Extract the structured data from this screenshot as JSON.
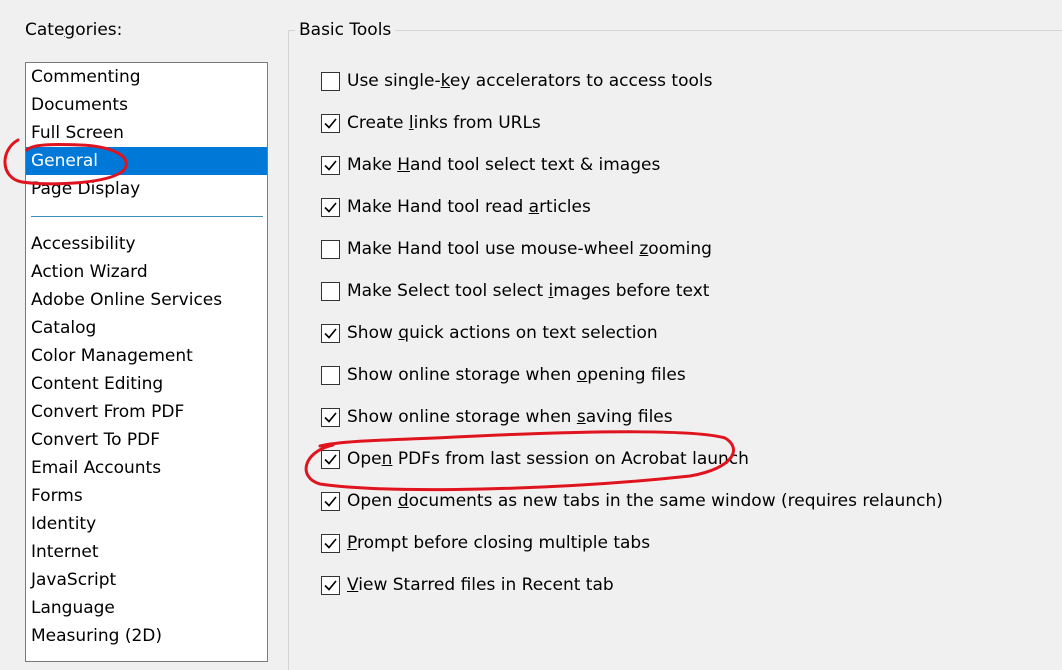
{
  "categories": {
    "label_pre": "Cate",
    "label_acc": "g",
    "label_post": "ories:",
    "items_top": [
      "Commenting",
      "Documents",
      "Full Screen",
      "General",
      "Page Display"
    ],
    "selected": "General",
    "items_bottom": [
      "Accessibility",
      "Action Wizard",
      "Adobe Online Services",
      "Catalog",
      "Color Management",
      "Content Editing",
      "Convert From PDF",
      "Convert To PDF",
      "Email Accounts",
      "Forms",
      "Identity",
      "Internet",
      "JavaScript",
      "Language",
      "Measuring (2D)"
    ]
  },
  "basic_tools": {
    "title": "Basic Tools",
    "options": [
      {
        "pre": "Use single-",
        "acc": "k",
        "post": "ey accelerators to access tools",
        "checked": false
      },
      {
        "pre": "Create ",
        "acc": "l",
        "post": "inks from URLs",
        "checked": true
      },
      {
        "pre": "Make ",
        "acc": "H",
        "post": "and tool select text & images",
        "checked": true
      },
      {
        "pre": "Make Hand tool read ",
        "acc": "a",
        "post": "rticles",
        "checked": true
      },
      {
        "pre": "Make Hand tool use mouse-wheel ",
        "acc": "z",
        "post": "ooming",
        "checked": false
      },
      {
        "pre": "Make Select tool select ",
        "acc": "i",
        "post": "mages before text",
        "checked": false
      },
      {
        "pre": "Show ",
        "acc": "q",
        "post": "uick actions on text selection",
        "checked": true
      },
      {
        "pre": "Show online storage when ",
        "acc": "o",
        "post": "pening files",
        "checked": false
      },
      {
        "pre": "Show online storage when ",
        "acc": "s",
        "post": "aving files",
        "checked": true
      },
      {
        "pre": "Ope",
        "acc": "n",
        "post": " PDFs from last session on Acrobat launch",
        "checked": true
      },
      {
        "pre": "Open ",
        "acc": "d",
        "post": "ocuments as new tabs in the same window (requires relaunch)",
        "checked": true
      },
      {
        "pre": "",
        "acc": "P",
        "post": "rompt before closing multiple tabs",
        "checked": true
      },
      {
        "pre": "",
        "acc": "V",
        "post": "iew Starred files in Recent tab",
        "checked": true
      }
    ]
  },
  "annotations": {
    "color": "#e0141e",
    "icon": "red-marker-circle"
  },
  "colors": {
    "selection": "#0078d7",
    "separator": "#3c8dbc"
  }
}
